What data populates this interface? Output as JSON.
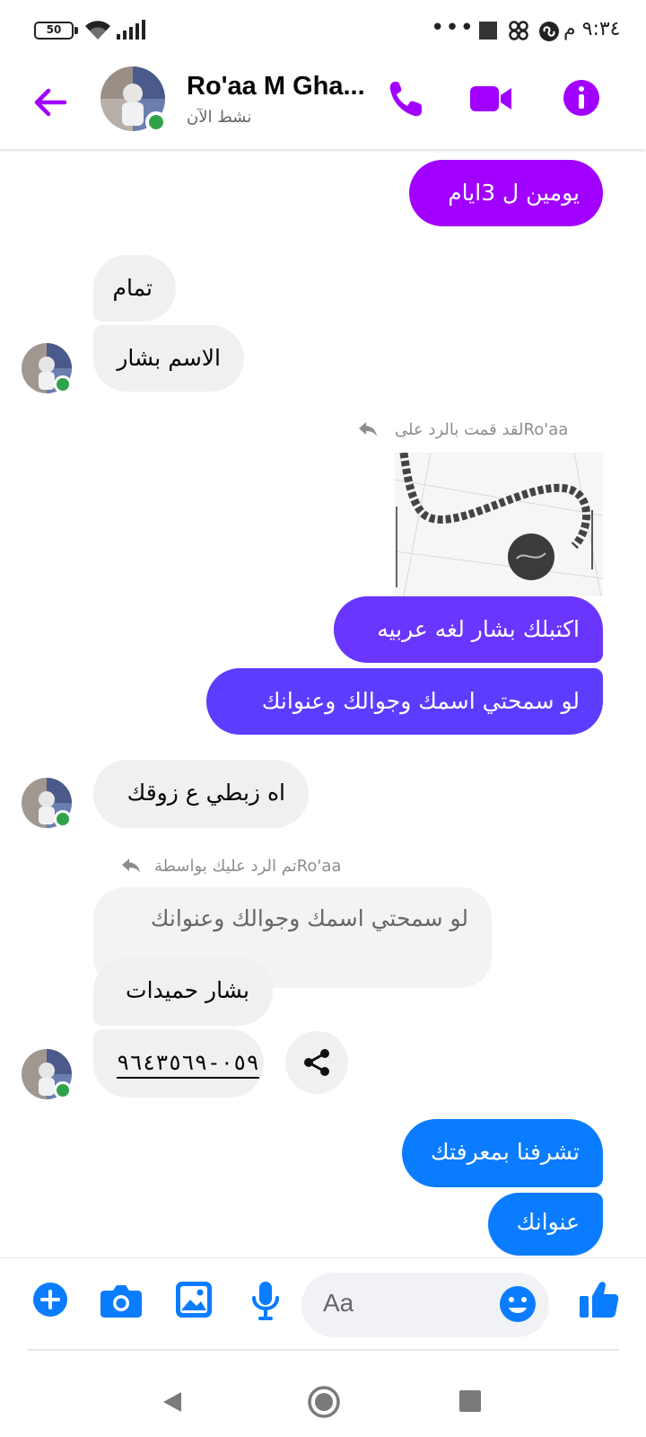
{
  "status_bar": {
    "battery": "50",
    "time": "٩:٣٤ م",
    "overflow": "•••"
  },
  "header": {
    "contact_name": "Ro'aa M Gha...",
    "status": "نشط الآن",
    "icons": [
      "back-arrow-icon",
      "phone-icon",
      "video-camera-icon",
      "info-icon"
    ]
  },
  "messages": {
    "m1": "يومين ل 3ايام",
    "m2": "تمام",
    "m3": "الاسم بشار",
    "reply_note_1": "Ro'aaلقد قمت بالرد على",
    "m4": "اكتبلك  بشار لغه عربيه",
    "m5": "لو سمحتي اسمك وجوالك وعنوانك",
    "m6": "اه زبطي ع زوقك",
    "reply_note_2": "Ro'aaتم الرد عليك بواسطة",
    "quoted": "لو سمحتي اسمك وجوالك وعنوانك",
    "m7": "بشار حميدات",
    "m8": "٠٥٩-٩٦٤٣٥٦٩",
    "m9": "تشرفنا بمعرفتك",
    "m10": "عنوانك"
  },
  "composer": {
    "placeholder": "Aa",
    "icons": [
      "plus-icon",
      "camera-icon",
      "gallery-icon",
      "microphone-icon",
      "emoji-icon",
      "thumbs-up-icon"
    ]
  },
  "colors": {
    "accent": "#a100ff",
    "bubble_violet": "#6a35ff",
    "bubble_indigo": "#5b3dff",
    "bubble_blue": "#0a7cff",
    "icon_blue": "#0a7cff",
    "online": "#31a24c"
  }
}
